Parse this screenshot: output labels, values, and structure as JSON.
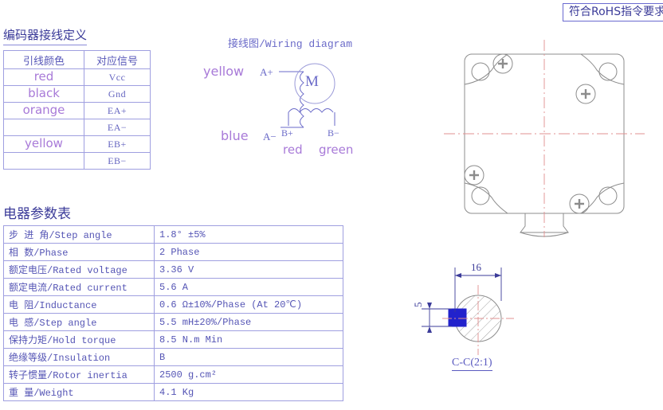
{
  "rohs": {
    "label": "符合RoHS指令要求"
  },
  "encoder": {
    "title": "编码器接线定义",
    "headers": [
      "引线颜色",
      "对应信号"
    ],
    "rows": [
      {
        "color": "red",
        "signal": "Vcc"
      },
      {
        "color": "black",
        "signal": "Gnd"
      },
      {
        "color": "orange",
        "signal": "EA+"
      },
      {
        "color": "",
        "signal": "EA−"
      },
      {
        "color": "yellow",
        "signal": "EB+"
      },
      {
        "color": "",
        "signal": "EB−"
      }
    ]
  },
  "wiring": {
    "title": "接线图/Wiring diagram",
    "motor_label": "M",
    "labels": {
      "yellow": "yellow",
      "blue": "blue",
      "red": "red",
      "green": "green"
    },
    "pins": {
      "a_plus": "A+",
      "a_minus": "A−",
      "b_plus": "B+",
      "b_minus": "B−"
    }
  },
  "section": {
    "label": "C-C(2:1)",
    "dim_diameter": "16",
    "dim_key": "5",
    "keyway_color": "#2222cc"
  },
  "params": {
    "title": "电器参数表",
    "rows": [
      {
        "name": "步 进 角/Step angle",
        "value": "1.8° ±5%"
      },
      {
        "name": "相    数/Phase",
        "value": "2   Phase"
      },
      {
        "name": "额定电压/Rated voltage",
        "value": "3.36  V"
      },
      {
        "name": "额定电流/Rated current",
        "value": "5.6   A"
      },
      {
        "name": "电    阻/Inductance",
        "value": "0.6 Ω±10%/Phase  (At 20℃)"
      },
      {
        "name": "电    感/Step angle",
        "value": "5.5 mH±20%/Phase"
      },
      {
        "name": "保持力矩/Hold torque",
        "value": "8.5 N.m   Min"
      },
      {
        "name": "绝缘等级/Insulation",
        "value": "B"
      },
      {
        "name": "转子惯量/Rotor inertia",
        "value": "2500 g.cm²"
      },
      {
        "name": "重    量/Weight",
        "value": "4.1 Kg"
      }
    ]
  },
  "colors": {
    "line": "#8a8ad8",
    "text": "#5555b5",
    "wire_text": "#a87ad8",
    "center_line": "#e09090",
    "drawing": "#808080"
  }
}
